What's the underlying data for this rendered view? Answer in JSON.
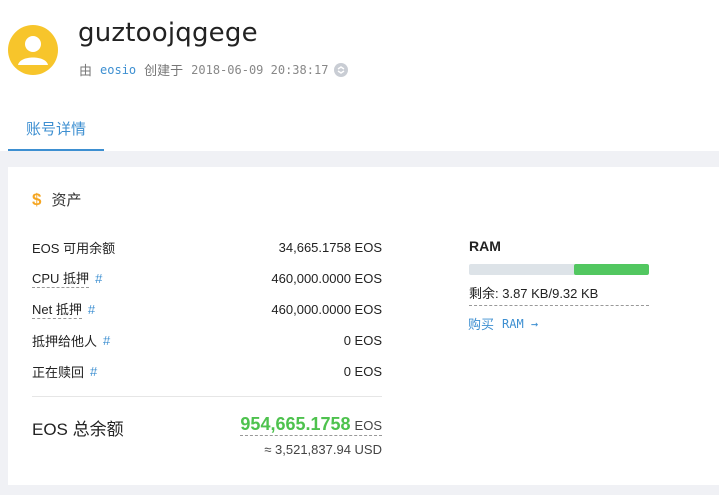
{
  "account": {
    "name": "guztoojqgege",
    "created_by_prefix": "由",
    "creator": "eosio",
    "created_label": "创建于",
    "created_time": "2018-06-09 20:38:17"
  },
  "tabs": [
    {
      "label": "账号详情",
      "active": true
    }
  ],
  "assets": {
    "title": "资产",
    "rows": [
      {
        "label": "EOS 可用余额",
        "value": "34,665.1758 EOS",
        "hash": ""
      },
      {
        "label": "CPU 抵押",
        "value": "460,000.0000 EOS",
        "hash": "#"
      },
      {
        "label": "Net 抵押",
        "value": "460,000.0000 EOS",
        "hash": "#"
      },
      {
        "label": "抵押给他人",
        "value": "0 EOS",
        "hash": "#"
      },
      {
        "label": "正在赎回",
        "value": "0 EOS",
        "hash": "#"
      }
    ],
    "total_label": "EOS 总余额",
    "total_value": "954,665.1758",
    "total_unit": "EOS",
    "usd_value": "≈ 3,521,837.94 USD"
  },
  "ram": {
    "title": "RAM",
    "remaining_text": "剩余: 3.87 KB/9.32 KB",
    "used_fraction": 0.415,
    "buy_prefix": "购买",
    "buy_label": "RAM →"
  },
  "colors": {
    "accent": "#3d8fd1",
    "green": "#52c760",
    "avatar": "#f7c52b",
    "dollar": "#f5a623"
  }
}
